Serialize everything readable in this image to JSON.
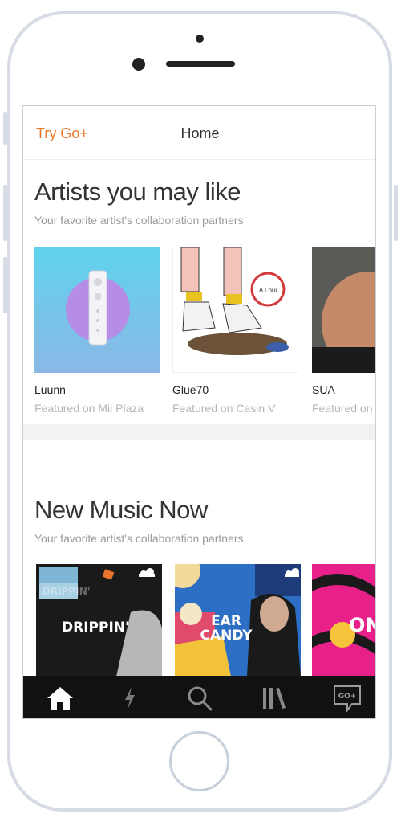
{
  "header": {
    "try_label": "Try Go+",
    "title": "Home"
  },
  "artists_section": {
    "title": "Artists you may like",
    "subtitle": "Your favorite artist's collaboration partners",
    "artists": [
      {
        "name": "Luunn",
        "featured": "Featured on Mii Plaza"
      },
      {
        "name": "Glue70",
        "featured": "Featured on Casin V"
      },
      {
        "name": "SUA",
        "featured": "Featured on"
      }
    ]
  },
  "new_music_section": {
    "title": "New Music Now",
    "subtitle": "Your favorite artist's collaboration partners",
    "playlists": [
      {
        "title": "DRIPPIN'"
      },
      {
        "title_line1": "EAR",
        "title_line2": "CANDY"
      },
      {
        "title": "ON"
      }
    ]
  },
  "sticker_text": "A Loui",
  "tabbar": {
    "tabs": [
      {
        "icon": "home-icon",
        "active": true
      },
      {
        "icon": "lightning-icon",
        "active": false
      },
      {
        "icon": "search-icon",
        "active": false
      },
      {
        "icon": "library-icon",
        "active": false
      },
      {
        "icon": "go-plus-icon",
        "label": "GO+",
        "active": false
      }
    ]
  },
  "colors": {
    "accent": "#e8792b",
    "tabbar": "#111111"
  }
}
